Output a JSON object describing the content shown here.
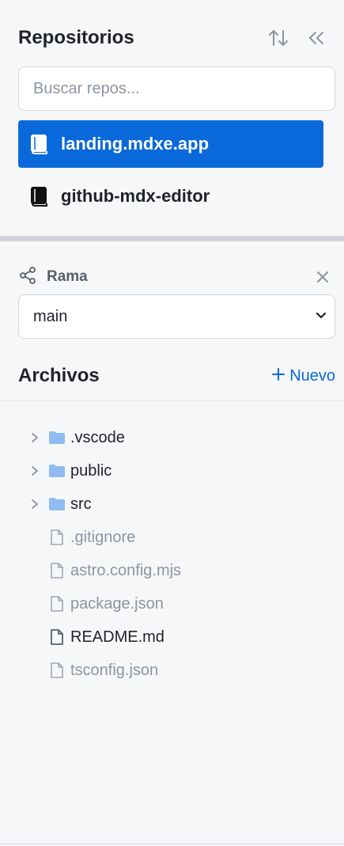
{
  "repositories": {
    "title": "Repositorios",
    "sort_icon": "sort-arrows-icon",
    "collapse_icon": "double-chevron-left-icon",
    "search_placeholder": "Buscar repos...",
    "search_value": "",
    "items": [
      {
        "name": "landing.mdxe.app",
        "icon": "book-icon",
        "active": true
      },
      {
        "name": "github-mdx-editor",
        "icon": "book-icon",
        "active": false
      }
    ]
  },
  "branch": {
    "label": "Rama",
    "icon": "branch-share-icon",
    "close_icon": "close-icon",
    "selected": "main",
    "dropdown_icon": "chevron-down-icon"
  },
  "files": {
    "title": "Archivos",
    "new_label": "Nuevo",
    "new_icon": "plus-icon",
    "tree": [
      {
        "name": ".vscode",
        "type": "folder"
      },
      {
        "name": "public",
        "type": "folder"
      },
      {
        "name": "src",
        "type": "folder"
      },
      {
        "name": ".gitignore",
        "type": "file"
      },
      {
        "name": "astro.config.mjs",
        "type": "file"
      },
      {
        "name": "package.json",
        "type": "file"
      },
      {
        "name": "README.md",
        "type": "file",
        "highlight": true
      },
      {
        "name": "tsconfig.json",
        "type": "file"
      }
    ]
  },
  "colors": {
    "accent": "#0969da",
    "folder": "#8fbcf0",
    "file_muted": "#8c959f",
    "background": "#f6f7f9"
  }
}
